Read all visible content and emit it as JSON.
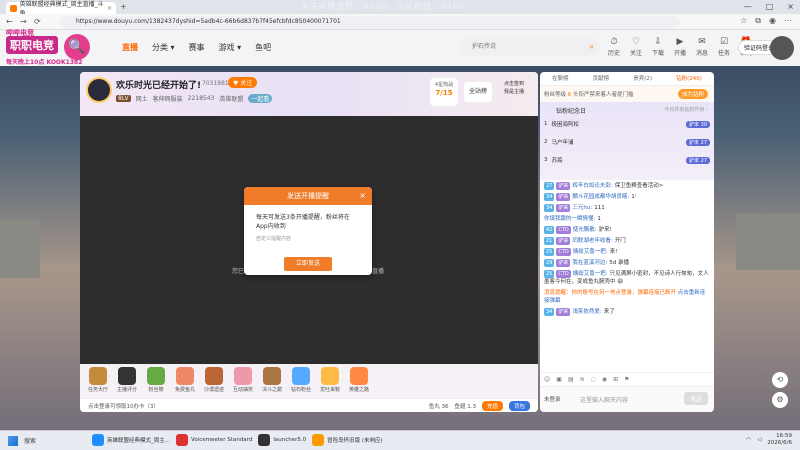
{
  "browser": {
    "tab_title": "英雄联盟经典模式_周主直播_斗鱼",
    "tab_close": "×",
    "new_tab": "+",
    "overlay_text": "关注本场点赞：6520，当前在线：8480",
    "url": "https://www.douyu.com/1382437dyshid=5adb4c-66b6d837b7f45efcbfdc85040007170​1",
    "window_controls": [
      "—",
      "□",
      "×"
    ]
  },
  "header": {
    "logo_top": "哔哔电竞",
    "logo_main": "职职电竞",
    "logo_bottom": "每天晚上10点 KOOK1382",
    "nav": [
      "首页",
      "直播",
      "分类 ▾",
      "赛事",
      "游戏 ▾",
      "鱼吧"
    ],
    "search_placeholder": "护石传说",
    "icons": [
      {
        "name": "history",
        "glyph": "⏱",
        "label": "历史"
      },
      {
        "name": "follow",
        "glyph": "♡",
        "label": "关注"
      },
      {
        "name": "download",
        "glyph": "⇩",
        "label": "下载"
      },
      {
        "name": "live",
        "glyph": "▶",
        "label": "开播"
      },
      {
        "name": "message",
        "glyph": "✉",
        "label": "消息"
      },
      {
        "name": "task",
        "glyph": "☑",
        "label": "任务"
      },
      {
        "name": "gift",
        "glyph": "🎁",
        "label": "福利"
      }
    ],
    "login_btn": "验证码登录号"
  },
  "room": {
    "title": "欢乐时光已经开始了!",
    "room_id": "7031881",
    "follow": "♥ 关注",
    "level_badge": "8LV",
    "tags": [
      "网土",
      "客伸网服装",
      "2218543",
      "英雄联盟",
      "一起看"
    ],
    "rank_label": "4星热战",
    "rank_value": "7/15",
    "all_btn": "全站榜",
    "side_btn_lines": [
      "点击签到",
      "我是主播"
    ],
    "video_text_left": "您已",
    "video_text_right": "直播"
  },
  "modal": {
    "title": "发送开播提醒",
    "close": "×",
    "body": "每天可发送3条开播提醒，粉丝将在App内收到",
    "sub": "自定义提醒内容",
    "button": "立即发送"
  },
  "gifts": [
    "任务大厅",
    "主播评分",
    "粉丝牌",
    "免费鱼丸",
    "沙漠遗迹",
    "互动抽奖",
    "决斗之巅",
    "钻石粉丝",
    "龙吐来鞍",
    "英雄之路"
  ],
  "bottombar": {
    "left": "点击登录可领取10办卡（3）",
    "fish": "鱼丸 36",
    "chip": "鱼翅 1.3",
    "recharge": "充值",
    "bag": "背包"
  },
  "chat": {
    "tabs": [
      "在聊榜",
      "贡献榜",
      "贵宾(2)",
      "钻粉(240)"
    ],
    "sub_label": "粉丝等级",
    "sub_value": "6",
    "sub_desc": "头衔严禁来着人者提门槛",
    "sub_btn": "成为钻粉",
    "fans_title": "钻粉纪念日",
    "fans_right": "今日共有钻粉升级 ›",
    "fans": [
      {
        "rank": "1",
        "name": "极困海阿松",
        "badge": "驴末 30"
      },
      {
        "rank": "2",
        "name": "马户年浦",
        "badge": "驴末 27"
      },
      {
        "rank": "3",
        "name": "苏捣",
        "badge": "驴末 27"
      }
    ],
    "messages": [
      {
        "lvl": "27",
        "fb": "驴来",
        "user": "辉辛白如论夫彭:",
        "text": "保卫鱼粮查看活动>"
      },
      {
        "lvl": "34",
        "fb": "驴来",
        "user": "麟斗花园成都华胡员瞎:",
        "text": "1'"
      },
      {
        "lvl": "34",
        "fb": "驴来",
        "user": "三元hu:",
        "text": "111"
      },
      {
        "lvl": "",
        "fb": "",
        "user": "你填我跟的一瞬情懂:",
        "text": "1"
      },
      {
        "lvl": "42",
        "fb": "CTD",
        "user": "使光飘散:",
        "text": "驴来!"
      },
      {
        "lvl": "21",
        "fb": "驴来",
        "user": "同联湖老年收看:",
        "text": "开门"
      },
      {
        "lvl": "25",
        "fb": "CTD",
        "user": "姨绥艾香一把:",
        "text": "来!"
      },
      {
        "lvl": "29",
        "fb": "驴来",
        "user": "我在蓝溪河边:",
        "text": "5d 录播"
      },
      {
        "lvl": "25",
        "fb": "CTD",
        "user": "姨绥艾香一把:",
        "text": "只见满屏小密封，不见诗人行匆匆，文人墨客今何在，变成鱼丸腕壳中 😄"
      },
      {
        "lvl": "",
        "fb": "",
        "user": "",
        "text": "消息提醒：你的账号在另一地点登录，弹幕连接已断开",
        "system": true,
        "link": "点击重新连接弹幕"
      },
      {
        "lvl": "34",
        "fb": "驴来",
        "user": "浅笑依然爱:",
        "text": "来了"
      }
    ],
    "tools": [
      "☺",
      "▣",
      "▤",
      "≋",
      "◌",
      "◉",
      "⊞",
      "⚑"
    ],
    "unlogged": "未登录",
    "input_placeholder": "这里输入聊天内容",
    "send": "发送"
  },
  "taskbar": {
    "search": "搜索",
    "apps": [
      {
        "label": "英雄联盟经典模式_周主...",
        "color": "#1f8fff"
      },
      {
        "label": "Voicemeeter Standard",
        "color": "#d33"
      },
      {
        "label": "launcher5.0",
        "color": "#333"
      },
      {
        "label": "冒险岛怀旧版 (未响应)",
        "color": "#f90"
      }
    ],
    "time": "16:59",
    "date": "2026/6/6"
  }
}
